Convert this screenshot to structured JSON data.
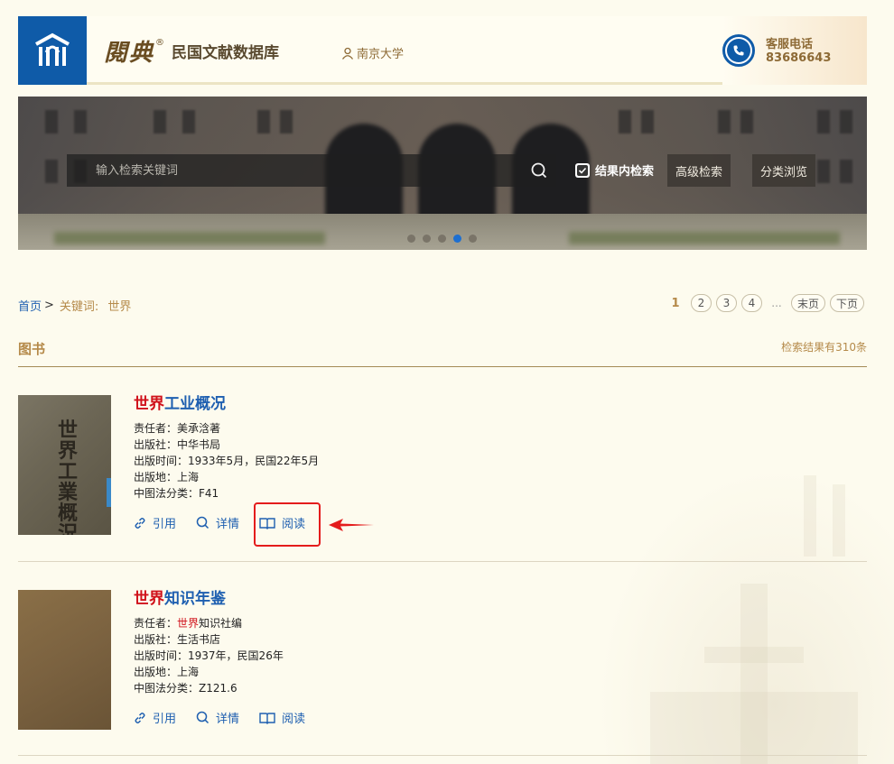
{
  "header": {
    "brand_script": "閱典",
    "brand_reg": "®",
    "brand_name": "民国文献数据库",
    "org": "南京大学",
    "phone_label": "客服电话",
    "phone_number": "83686643",
    "accent_color": "#0f5ba8"
  },
  "search": {
    "placeholder": "输入检索关键词",
    "value": "",
    "within_results_label": "结果内检索",
    "within_results_checked": true,
    "advanced_label": "高级检索",
    "browse_label": "分类浏览"
  },
  "carousel": {
    "slide_count": 5,
    "active_index": 4
  },
  "breadcrumb": {
    "home": "首页",
    "sep": ">",
    "keyword_label": "关键词:",
    "keyword": "世界"
  },
  "pager": {
    "current": "1",
    "pages": [
      "2",
      "3",
      "4"
    ],
    "ellipsis": "...",
    "last": "末页",
    "next": "下页"
  },
  "section": {
    "title": "图书",
    "result_count": "检索结果有310条"
  },
  "results": [
    {
      "title_hl": "世界",
      "title_rest": "工业概况",
      "cover_text": "世界工業概況",
      "author_label": "责任者：",
      "author_hl": "",
      "author": "美承浛著",
      "publisher_label": "出版社：",
      "publisher": "中华书局",
      "date_label": "出版时间：",
      "date": "1933年5月，民国22年5月",
      "place_label": "出版地：",
      "place": "上海",
      "class_label": "中图法分类：",
      "class": "F41",
      "cite": "引用",
      "detail": "详情",
      "read": "阅读"
    },
    {
      "title_hl": "世界",
      "title_rest": "知识年鉴",
      "cover_text": "",
      "author_label": "责任者：",
      "author_hl": "世界",
      "author": "知识社编",
      "publisher_label": "出版社：",
      "publisher": "生活书店",
      "date_label": "出版时间：",
      "date": "1937年，民国26年",
      "place_label": "出版地：",
      "place": "上海",
      "class_label": "中图法分类：",
      "class": "Z121.6",
      "cite": "引用",
      "detail": "详情",
      "read": "阅读"
    }
  ]
}
